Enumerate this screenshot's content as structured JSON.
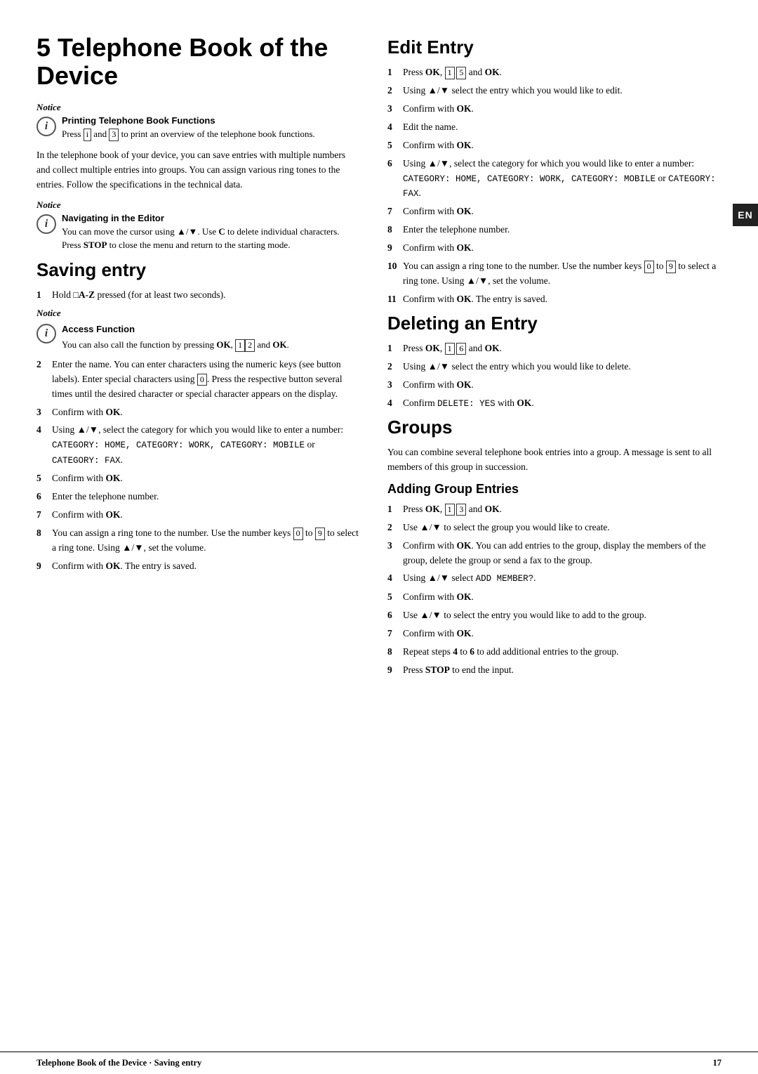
{
  "page": {
    "chapter_number": "5",
    "chapter_title": "Telephone Book of the Device",
    "en_tab": "EN",
    "footer_left": "Telephone Book of the Device · Saving entry",
    "footer_right": "17"
  },
  "notice1": {
    "label": "Notice",
    "heading": "Printing Telephone Book Functions",
    "text": "Press i and 3 to print an overview of the telephone book functions."
  },
  "intro_text": "In the telephone book of your device, you can save entries with multiple numbers and collect multiple entries into groups. You can assign various ring tones to the entries. Follow the specifications in the technical data.",
  "notice2": {
    "label": "Notice",
    "heading": "Navigating in the Editor",
    "text": "You can move the cursor using ▲/▼. Use C to delete individual characters. Press STOP to close the menu and return to the starting mode."
  },
  "saving_entry": {
    "title": "Saving entry",
    "steps": [
      {
        "num": "1",
        "text": "Hold □A-Z pressed (for at least two seconds)."
      },
      {
        "num": "2",
        "text": "Enter the name. You can enter characters using the numeric keys (see button labels). Enter special characters using 0. Press the respective button several times until the desired character or special character appears on the display."
      },
      {
        "num": "3",
        "text": "Confirm with OK."
      },
      {
        "num": "4",
        "text": "Using ▲/▼, select the category for which you would like to enter a number: CATEGORY: HOME, CATEGORY: WORK, CATEGORY: MOBILE or CATEGORY: FAX."
      },
      {
        "num": "5",
        "text": "Confirm with OK."
      },
      {
        "num": "6",
        "text": "Enter the telephone number."
      },
      {
        "num": "7",
        "text": "Confirm with OK."
      },
      {
        "num": "8",
        "text": "You can assign a ring tone to the number. Use the number keys 0 to 9 to select a ring tone. Using ▲/▼, set the volume."
      },
      {
        "num": "9",
        "text": "Confirm with OK. The entry is saved."
      }
    ],
    "notice": {
      "label": "Notice",
      "heading": "Access Function",
      "text": "You can also call the function by pressing OK, 1 2 and OK."
    }
  },
  "edit_entry": {
    "title": "Edit Entry",
    "steps": [
      {
        "num": "1",
        "text": "Press OK, 1 5 and OK."
      },
      {
        "num": "2",
        "text": "Using ▲/▼ select the entry which you would like to edit."
      },
      {
        "num": "3",
        "text": "Confirm with OK."
      },
      {
        "num": "4",
        "text": "Edit the name."
      },
      {
        "num": "5",
        "text": "Confirm with OK."
      },
      {
        "num": "6",
        "text": "Using ▲/▼, select the category for which you would like to enter a number: CATEGORY: HOME, CATEGORY: WORK, CATEGORY: MOBILE or CATEGORY: FAX."
      },
      {
        "num": "7",
        "text": "Confirm with OK."
      },
      {
        "num": "8",
        "text": "Enter the telephone number."
      },
      {
        "num": "9",
        "text": "Confirm with OK."
      },
      {
        "num": "10",
        "text": "You can assign a ring tone to the number. Use the number keys 0 to 9 to select a ring tone. Using ▲/▼, set the volume."
      },
      {
        "num": "11",
        "text": "Confirm with OK. The entry is saved."
      }
    ]
  },
  "deleting_entry": {
    "title": "Deleting an Entry",
    "steps": [
      {
        "num": "1",
        "text": "Press OK, 1 6 and OK."
      },
      {
        "num": "2",
        "text": "Using ▲/▼ select the entry which you would like to delete."
      },
      {
        "num": "3",
        "text": "Confirm with OK."
      },
      {
        "num": "4",
        "text": "Confirm DELETE: YES with OK."
      }
    ]
  },
  "groups": {
    "title": "Groups",
    "intro": "You can combine several telephone book entries into a group. A message is sent to all members of this group in succession.",
    "adding_group": {
      "title": "Adding Group Entries",
      "steps": [
        {
          "num": "1",
          "text": "Press OK, 1 3 and OK."
        },
        {
          "num": "2",
          "text": "Use ▲/▼ to select the group you would like to create."
        },
        {
          "num": "3",
          "text": "Confirm with OK. You can add entries to the group, display the members of the group, delete the group or send a fax to the group."
        },
        {
          "num": "4",
          "text": "Using ▲/▼ select ADD MEMBER?."
        },
        {
          "num": "5",
          "text": "Confirm with OK."
        },
        {
          "num": "6",
          "text": "Use ▲/▼ to select the entry you would like to add to the group."
        },
        {
          "num": "7",
          "text": "Confirm with OK."
        },
        {
          "num": "8",
          "text": "Repeat steps 4 to 6 to add additional entries to the group."
        },
        {
          "num": "9",
          "text": "Press STOP to end the input."
        }
      ]
    }
  }
}
